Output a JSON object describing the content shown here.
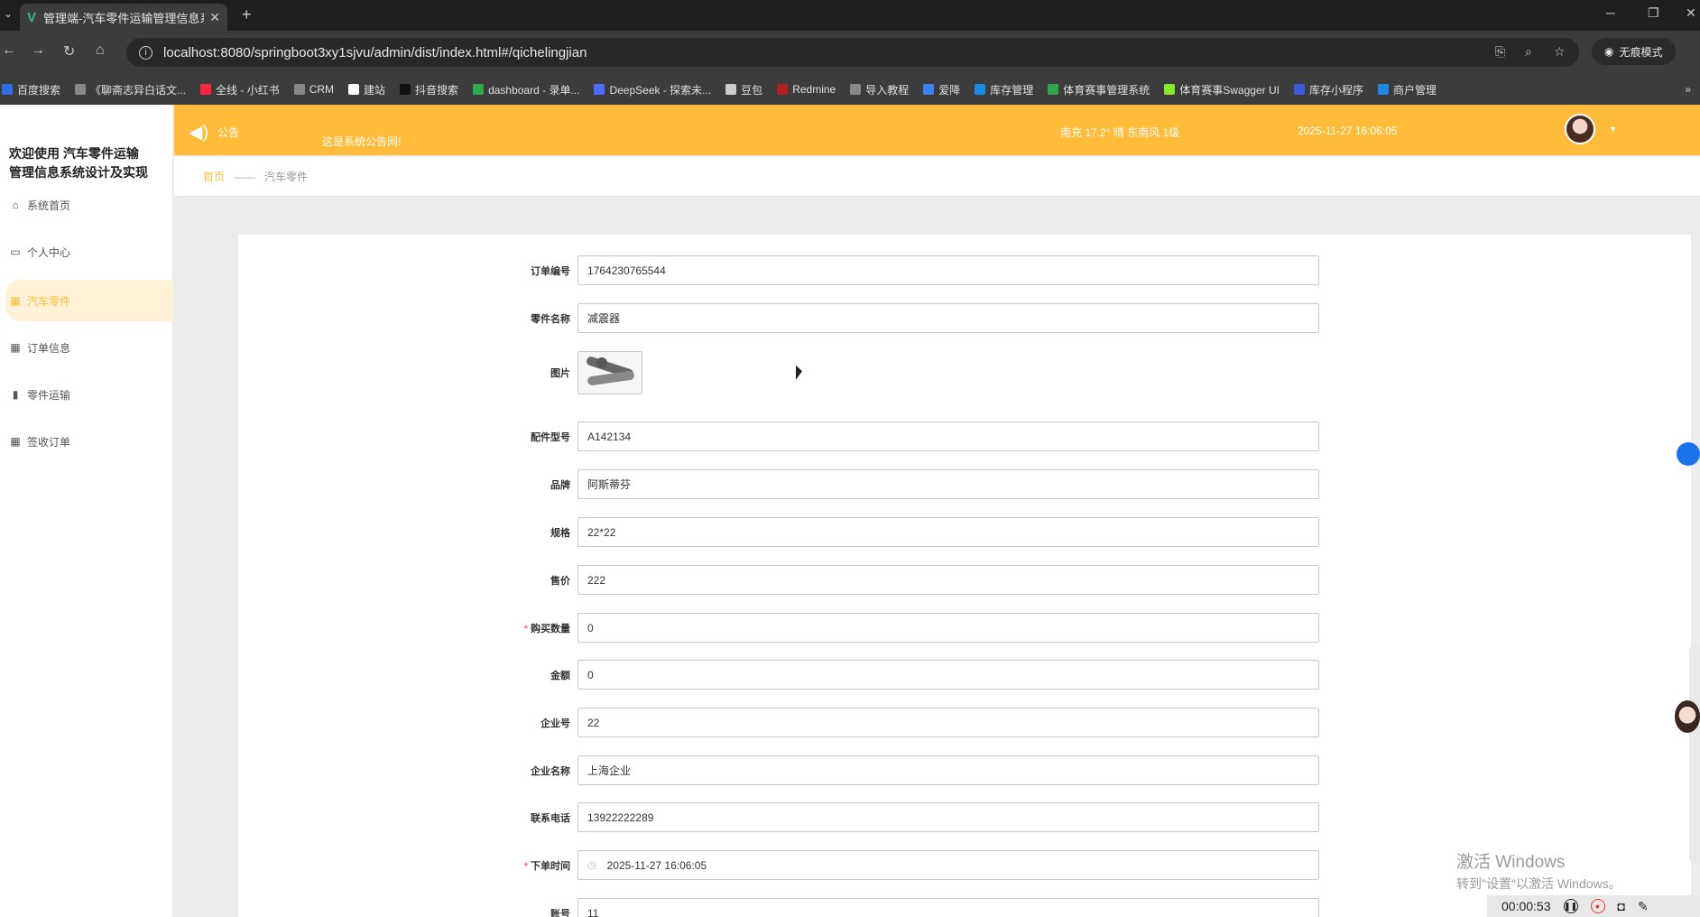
{
  "browser": {
    "tab_title": "管理端-汽车零件运输管理信息系统",
    "url": "localhost:8080/springboot3xy1sjvu/admin/dist/index.html#/qichelingjian",
    "incognito_label": "无痕模式",
    "bookmarks": [
      {
        "label": "百度搜索",
        "color": "#2b6ee5"
      },
      {
        "label": "《聊斋志异白话文...",
        "color": "#888888"
      },
      {
        "label": "全线 - 小红书",
        "color": "#ff2442"
      },
      {
        "label": "CRM",
        "color": "#888888"
      },
      {
        "label": "建站",
        "color": "#ffffff"
      },
      {
        "label": "抖音搜索",
        "color": "#111111"
      },
      {
        "label": "dashboard - 录单...",
        "color": "#2fa84f"
      },
      {
        "label": "DeepSeek - 探索未...",
        "color": "#4d6bfe"
      },
      {
        "label": "豆包",
        "color": "#cccccc"
      },
      {
        "label": "Redmine",
        "color": "#b32024"
      },
      {
        "label": "导入教程",
        "color": "#888888"
      },
      {
        "label": "爱降",
        "color": "#3b82f6"
      },
      {
        "label": "库存管理",
        "color": "#1e88e5"
      },
      {
        "label": "体育赛事管理系统",
        "color": "#2fa84f"
      },
      {
        "label": "体育赛事Swagger UI",
        "color": "#85ea2d"
      },
      {
        "label": "库存小程序",
        "color": "#3b5bdb"
      },
      {
        "label": "商户管理",
        "color": "#1e88e5"
      }
    ]
  },
  "sidebar": {
    "brand": "欢迎使用 汽车零件运输管理信息系统设计及实现",
    "items": [
      {
        "label": "系统首页",
        "icon": "home-icon",
        "glyph": "⌂"
      },
      {
        "label": "个人中心",
        "icon": "profile-icon",
        "glyph": "▭"
      },
      {
        "label": "汽车零件",
        "icon": "grid-icon",
        "glyph": "▦"
      },
      {
        "label": "订单信息",
        "icon": "grid-icon",
        "glyph": "▦"
      },
      {
        "label": "零件运输",
        "icon": "bar-chart-icon",
        "glyph": "▮"
      },
      {
        "label": "签收订单",
        "icon": "apps-icon",
        "glyph": "▦"
      }
    ]
  },
  "header": {
    "notice_label": "公告",
    "notice_text": "这是系统公告网!",
    "weather": "南充  17.2°  晴  东南风  1级",
    "datetime": "2025-11-27 16:06:05"
  },
  "breadcrumb": {
    "home": "首页",
    "sep": "——",
    "current": "汽车零件"
  },
  "form": {
    "fields": [
      {
        "label": "订单编号",
        "value": "1764230765544",
        "required": false
      },
      {
        "label": "零件名称",
        "value": "减震器",
        "required": false
      },
      {
        "label": "图片",
        "value": "",
        "required": false
      },
      {
        "label": "配件型号",
        "value": "A142134",
        "required": false
      },
      {
        "label": "品牌",
        "value": "阿斯蒂芬",
        "required": false
      },
      {
        "label": "规格",
        "value": "22*22",
        "required": false
      },
      {
        "label": "售价",
        "value": "222",
        "required": false
      },
      {
        "label": "购买数量",
        "value": "0",
        "required": true
      },
      {
        "label": "金额",
        "value": "0",
        "required": false
      },
      {
        "label": "企业号",
        "value": "22",
        "required": false
      },
      {
        "label": "企业名称",
        "value": "上海企业",
        "required": false
      },
      {
        "label": "联系电话",
        "value": "13922222289",
        "required": false
      },
      {
        "label": "下单时间",
        "value": "2025-11-27 16:06:05",
        "required": true
      },
      {
        "label": "账号",
        "value": "11",
        "required": false
      }
    ],
    "required_mark": "*"
  },
  "watermark": {
    "title": "激活 Windows",
    "sub": "转到\"设置\"以激活 Windows。"
  },
  "recorder": {
    "time": "00:00:53"
  },
  "colors": {
    "accent": "#ffbb3a",
    "active_bg": "#fff2d6",
    "required": "#f56c6c"
  }
}
